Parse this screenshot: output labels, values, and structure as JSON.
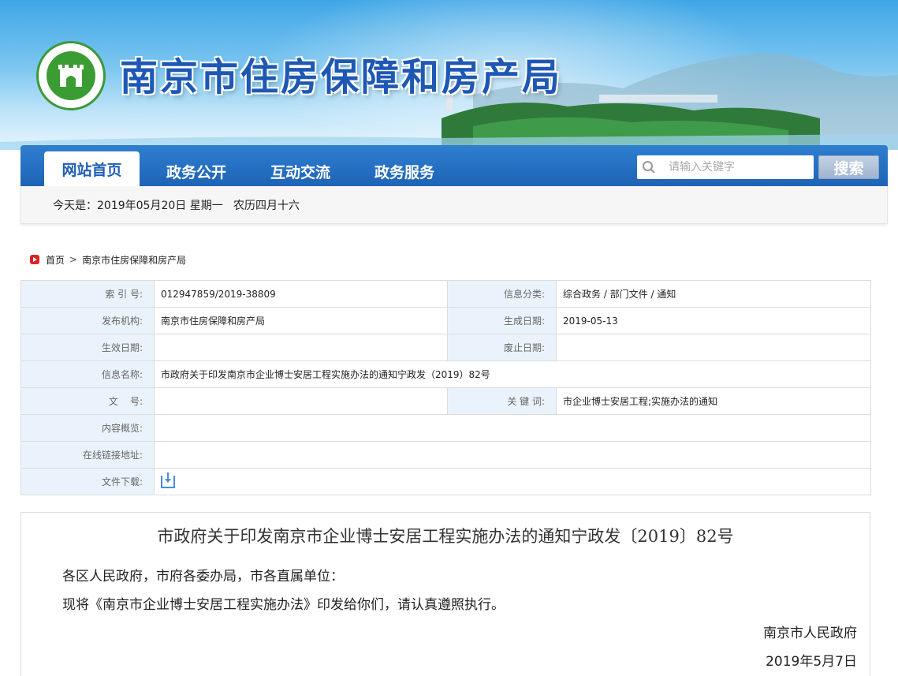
{
  "header": {
    "site_title": "南京市住房保障和房产局"
  },
  "nav": {
    "tabs": [
      {
        "label": "网站首页",
        "active": true
      },
      {
        "label": "政务公开",
        "active": false
      },
      {
        "label": "互动交流",
        "active": false
      },
      {
        "label": "政务服务",
        "active": false
      }
    ],
    "search_placeholder": "请输入关键字",
    "search_button": "搜索"
  },
  "date_bar": {
    "text": "今天是：2019年05月20日 星期一   农历四月十六"
  },
  "breadcrumb": {
    "home": "首页",
    "current": "南京市住房保障和房产局"
  },
  "info_table": {
    "index_label": "索 引 号:",
    "index_value": "012947859/2019-38809",
    "category_label": "信息分类:",
    "category_value": "综合政务 / 部门文件 / 通知",
    "publisher_label": "发布机构:",
    "publisher_value": "南京市住房保障和房产局",
    "created_label": "生成日期:",
    "created_value": "2019-05-13",
    "effective_label": "生效日期:",
    "effective_value": "",
    "expire_label": "废止日期:",
    "expire_value": "",
    "name_label": "信息名称:",
    "name_value": "市政府关于印发南京市企业博士安居工程实施办法的通知宁政发（2019）82号",
    "docno_label": "文    号:",
    "docno_value": "",
    "keywords_label": "关 键 词:",
    "keywords_value": "市企业博士安居工程;实施办法的通知",
    "summary_label": "内容概览:",
    "summary_value": "",
    "link_label": "在线链接地址:",
    "link_value": "",
    "download_label": "文件下载:"
  },
  "article": {
    "title": "市政府关于印发南京市企业博士安居工程实施办法的通知宁政发〔2019〕82号",
    "salutation": "各区人民政府，市府各委办局，市各直属单位：",
    "body": "现将《南京市企业博士安居工程实施办法》印发给你们，请认真遵照执行。",
    "signature": "南京市人民政府",
    "date": "2019年5月7日"
  },
  "colors": {
    "nav_blue": "#1e63b6",
    "title_blue": "#1e58b5",
    "label_bg": "#eaf3fb",
    "logo_green": "#3c9c34"
  }
}
